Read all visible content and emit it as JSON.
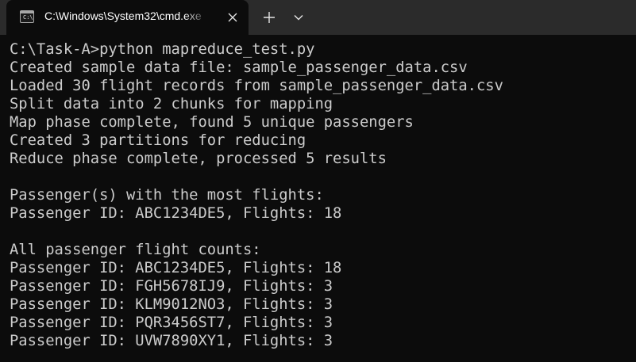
{
  "window": {
    "tab_title": "C:\\Windows\\System32\\cmd.exe",
    "icons": {
      "tab": "cmd-terminal-icon",
      "close": "close-icon",
      "new_tab": "plus-icon",
      "dropdown": "chevron-down-icon"
    }
  },
  "terminal": {
    "lines": [
      "C:\\Task-A>python mapreduce_test.py",
      "Created sample data file: sample_passenger_data.csv",
      "Loaded 30 flight records from sample_passenger_data.csv",
      "Split data into 2 chunks for mapping",
      "Map phase complete, found 5 unique passengers",
      "Created 3 partitions for reducing",
      "Reduce phase complete, processed 5 results",
      "",
      "Passenger(s) with the most flights:",
      "Passenger ID: ABC1234DE5, Flights: 18",
      "",
      "All passenger flight counts:",
      "Passenger ID: ABC1234DE5, Flights: 18",
      "Passenger ID: FGH5678IJ9, Flights: 3",
      "Passenger ID: KLM9012NO3, Flights: 3",
      "Passenger ID: PQR3456ST7, Flights: 3",
      "Passenger ID: UVW7890XY1, Flights: 3"
    ]
  },
  "colors": {
    "terminal_bg": "#0c0c0c",
    "titlebar_bg": "#2b2b2b",
    "text": "#cccccc"
  }
}
